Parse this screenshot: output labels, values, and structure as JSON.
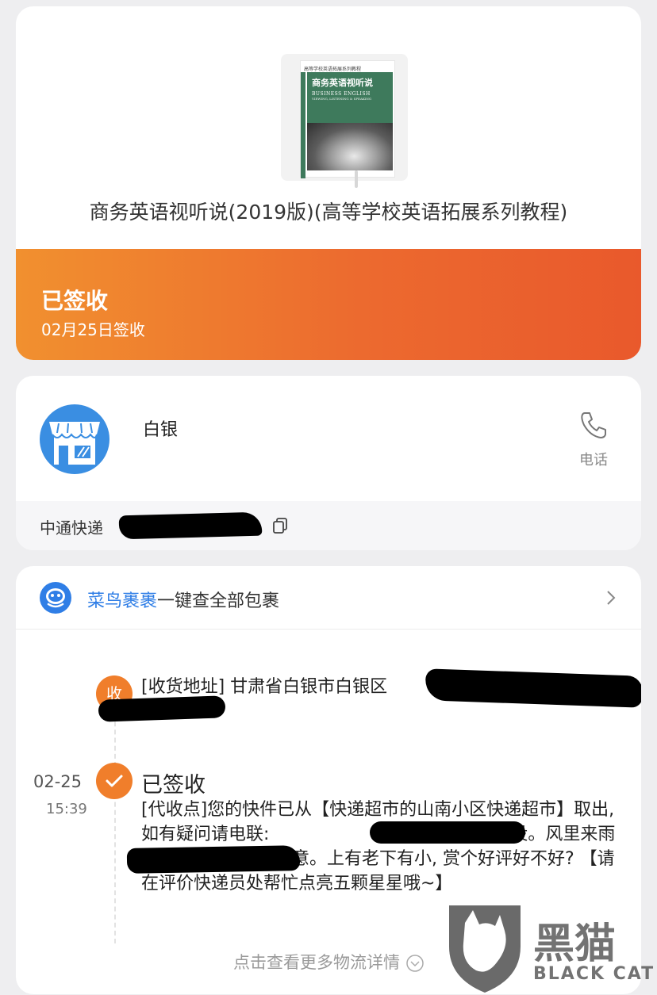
{
  "product": {
    "cover_series_top": "高等学校英语拓展系列教程",
    "cover_title": "商务英语视听说",
    "cover_subtitle": "BUSINESS ENGLISH",
    "cover_subtitle2": "VIEWING, LISTENING & SPEAKING",
    "title": "商务英语视听说(2019版)(高等学校英语拓展系列教程)"
  },
  "status": {
    "title": "已签收",
    "date": "02月25日签收",
    "banner_color": "#ec6a2f"
  },
  "station": {
    "name": "白银",
    "phone_label": "电话",
    "courier": "中通快递"
  },
  "cainiao": {
    "brand": "菜鸟裹裹",
    "text": "一键查全部包裹",
    "brand_color": "#2f7ee6"
  },
  "timeline": {
    "receive_badge": "收",
    "address": "[收货地址] 甘肃省白银市白银区",
    "event": {
      "date": "02-25",
      "time": "15:39",
      "title": "已签收",
      "body_1": "[代收点]您的快件已从【快递超市的山南小区快递超市】取出,如有疑问请电联:",
      "body_2": "您的快递已经妥投。风里来雨里去, 只为客官您满意。上有老下有小, 赏个好评好不好? 【请在评价快递员处帮忙点亮五颗星星哦~】"
    },
    "more": "点击查看更多物流详情",
    "node_color": "#f07e2b"
  },
  "watermark": {
    "text_cn": "黑猫",
    "text_en": "BLACK CAT"
  }
}
